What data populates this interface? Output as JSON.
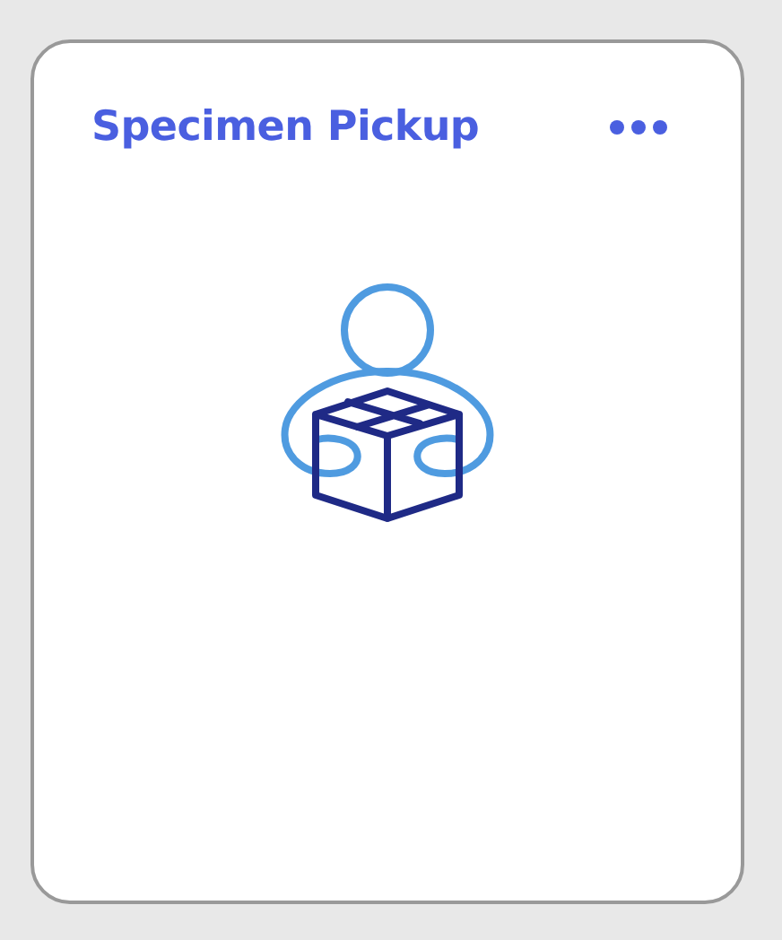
{
  "card": {
    "title": "Specimen Pickup"
  }
}
